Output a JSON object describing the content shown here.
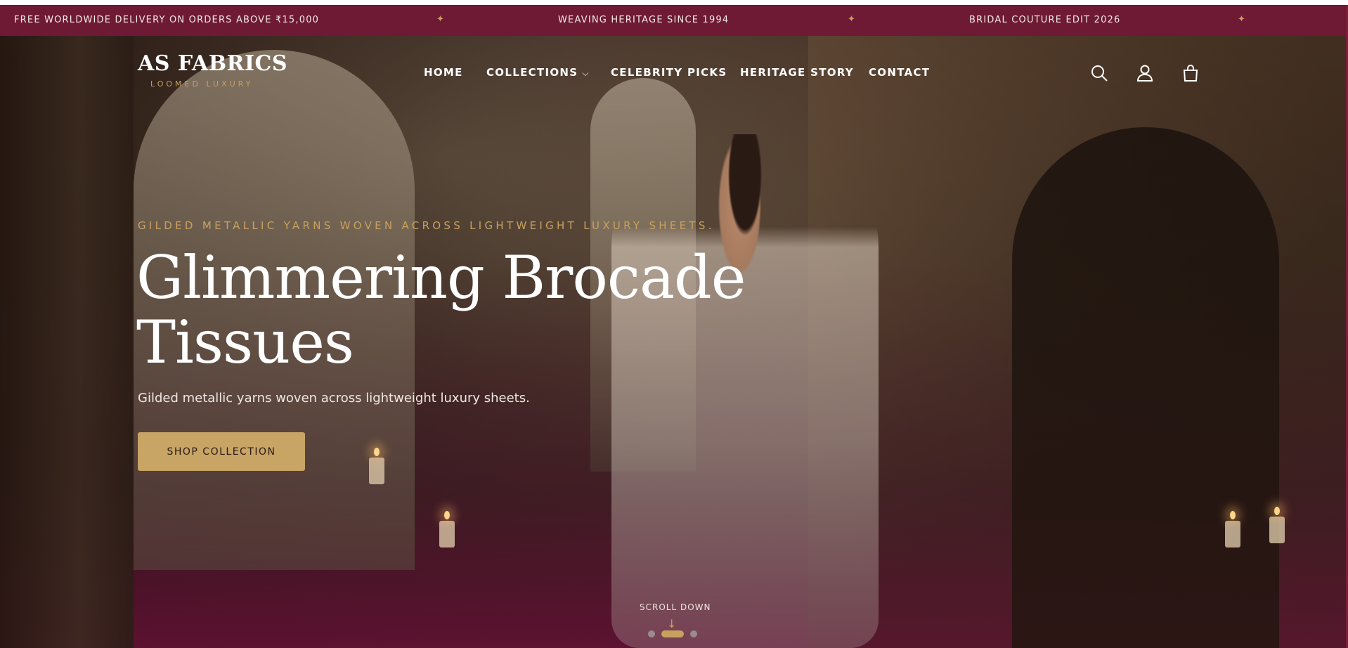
{
  "announcement": {
    "messages": [
      "FREE WORLDWIDE DELIVERY ON ORDERS ABOVE ₹15,000",
      "WEAVING HERITAGE SINCE 1994",
      "BRIDAL COUTURE EDIT 2026"
    ],
    "separator": "✦"
  },
  "brand": {
    "name": "AS FABRICS",
    "tagline": "LOOMED LUXURY"
  },
  "nav": {
    "items": [
      {
        "label": "HOME"
      },
      {
        "label": "COLLECTIONS"
      },
      {
        "label": "CELEBRITY PICKS"
      },
      {
        "label": "HERITAGE STORY"
      },
      {
        "label": "CONTACT"
      }
    ],
    "icons": [
      "search-icon",
      "user-icon",
      "shopping-bag-icon"
    ]
  },
  "hero": {
    "eyebrow": "GILDED METALLIC YARNS WOVEN ACROSS LIGHTWEIGHT LUXURY SHEETS.",
    "headline_line1": "Glimmering Brocade",
    "headline_line2": "Tissues",
    "subline": "Gilded metallic yarns woven across lightweight luxury sheets.",
    "cta_label": "SHOP COLLECTION",
    "scroll_label": "SCROLL DOWN",
    "scroll_arrow": "↓",
    "slides_total": 3,
    "slide_active": 2
  },
  "colors": {
    "announcement_bg": "#6e1a35",
    "accent_gold": "#c9a05d",
    "cta_bg": "#c8a465"
  }
}
